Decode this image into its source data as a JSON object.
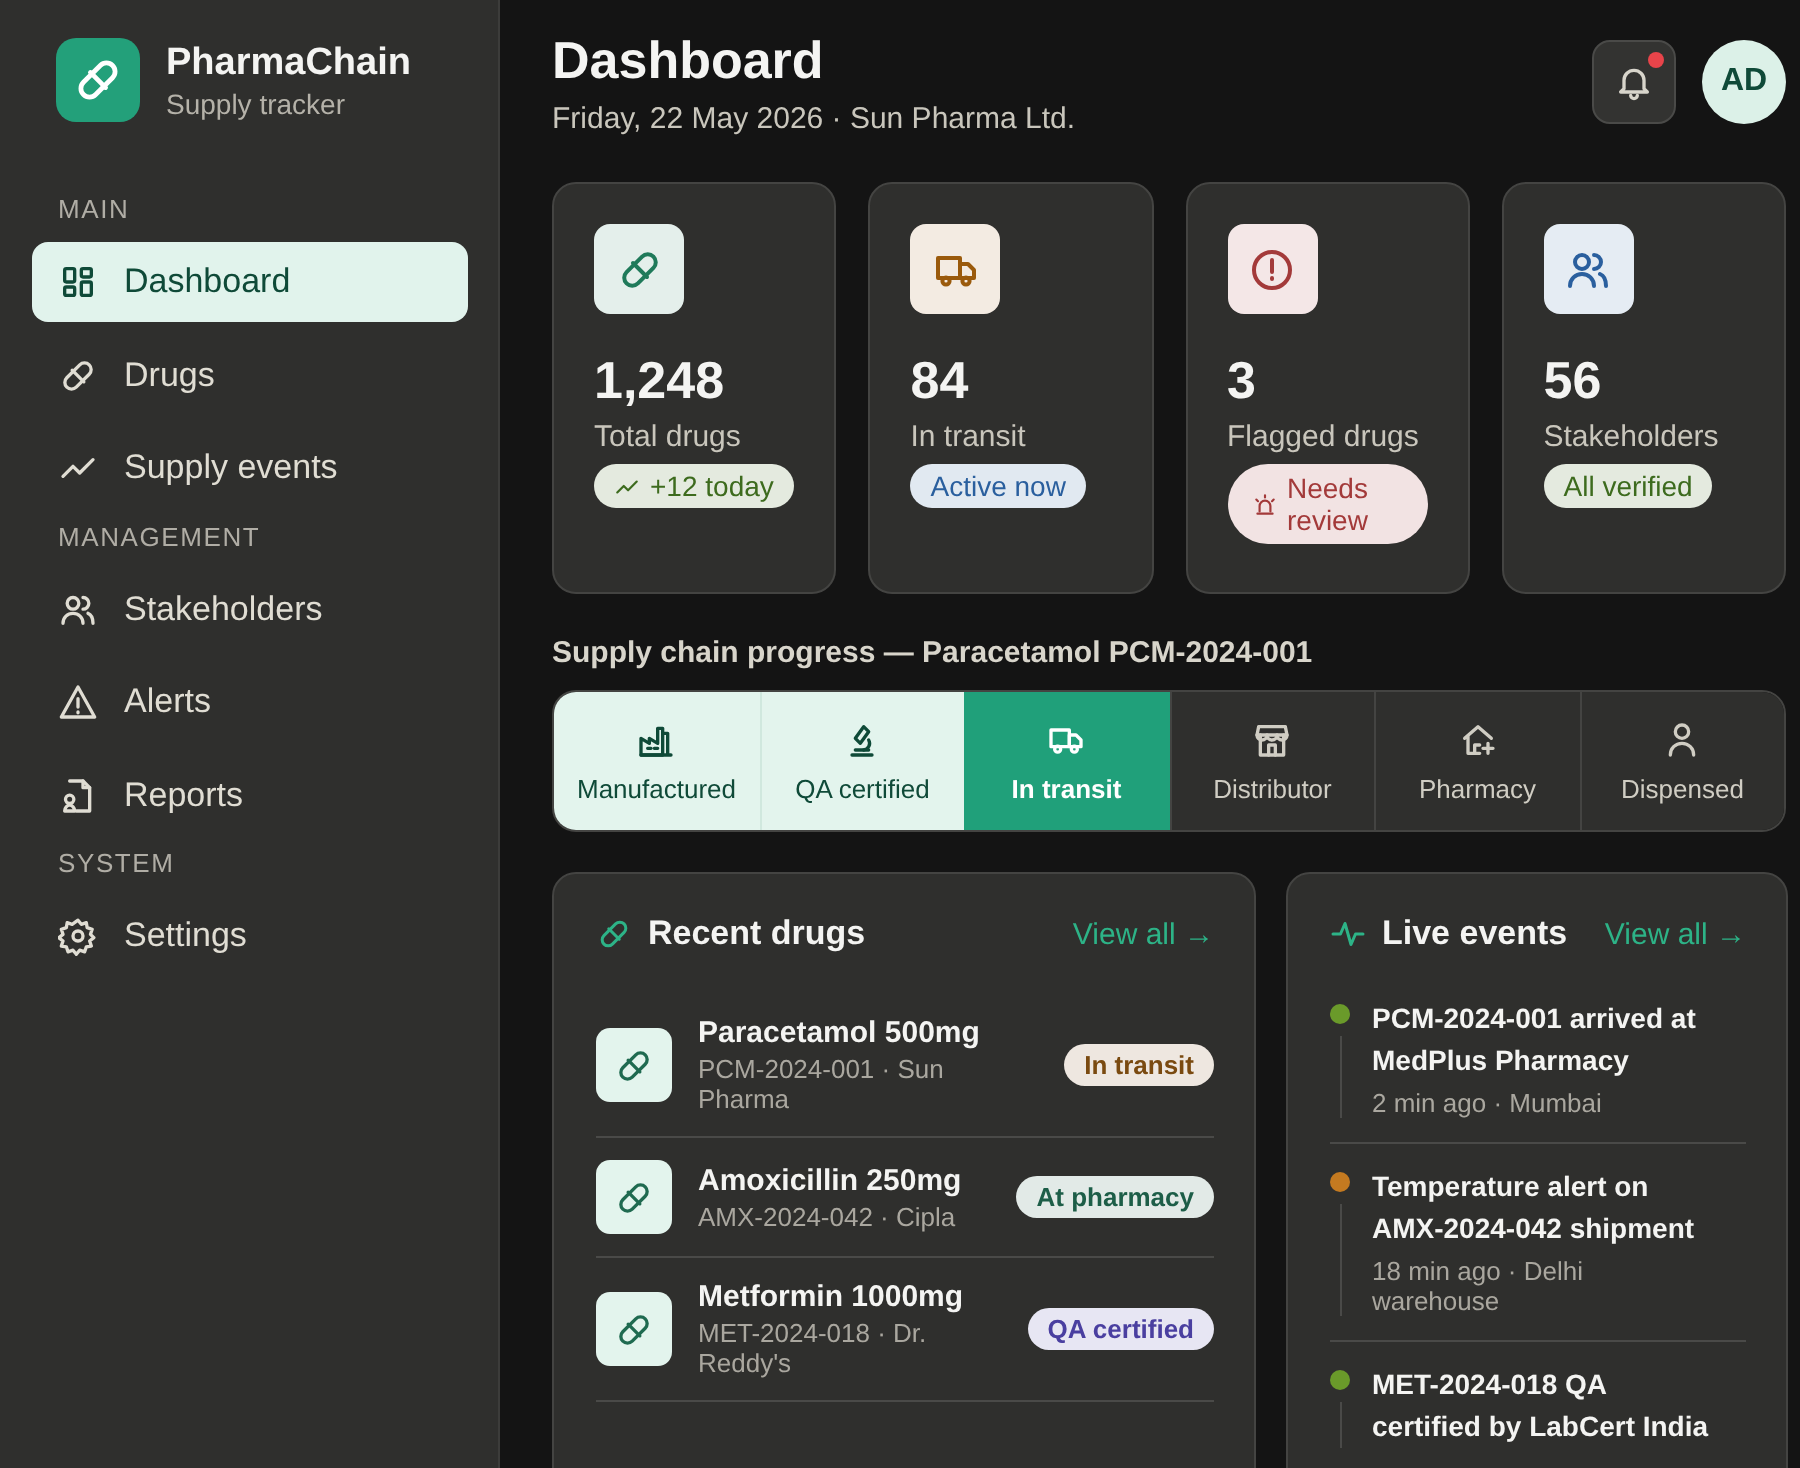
{
  "sidebar": {
    "brand": {
      "name": "PharmaChain",
      "tagline": "Supply tracker"
    },
    "sections": [
      {
        "heading": "MAIN",
        "items": [
          {
            "label": "Dashboard",
            "selected": true
          },
          {
            "label": "Drugs",
            "selected": false
          },
          {
            "label": "Supply events",
            "selected": false
          }
        ]
      },
      {
        "heading": "MANAGEMENT",
        "items": [
          {
            "label": "Stakeholders",
            "selected": false
          },
          {
            "label": "Alerts",
            "selected": false
          },
          {
            "label": "Reports",
            "selected": false
          }
        ]
      },
      {
        "heading": "SYSTEM",
        "items": [
          {
            "label": "Settings",
            "selected": false
          }
        ]
      }
    ]
  },
  "header": {
    "title": "Dashboard",
    "subtitle": "Friday, 22 May 2026 · Sun Pharma Ltd.",
    "notifications": {
      "unread": true
    },
    "avatar": "AD"
  },
  "stats": [
    {
      "value": "1,248",
      "label": "Total drugs",
      "badge": "+12 today"
    },
    {
      "value": "84",
      "label": "In transit",
      "badge": "Active now"
    },
    {
      "value": "3",
      "label": "Flagged drugs",
      "badge": "Needs review"
    },
    {
      "value": "56",
      "label": "Stakeholders",
      "badge": "All verified"
    }
  ],
  "progress": {
    "title": "Supply chain progress — Paracetamol PCM-2024-001",
    "steps": [
      {
        "label": "Manufactured",
        "completed": true,
        "selected": false
      },
      {
        "label": "QA certified",
        "completed": true,
        "selected": false
      },
      {
        "label": "In transit",
        "completed": false,
        "selected": true
      },
      {
        "label": "Distributor",
        "completed": false,
        "selected": false
      },
      {
        "label": "Pharmacy",
        "completed": false,
        "selected": false
      },
      {
        "label": "Dispensed",
        "completed": false,
        "selected": false
      }
    ]
  },
  "recent_drugs": {
    "title": "Recent drugs",
    "link": "View all →",
    "rows": [
      {
        "name": "Paracetamol 500mg",
        "meta": "PCM-2024-001 · Sun Pharma",
        "status": "In transit",
        "kind": "transit"
      },
      {
        "name": "Amoxicillin 250mg",
        "meta": "AMX-2024-042 · Cipla",
        "status": "At pharmacy",
        "kind": "pharmacy"
      },
      {
        "name": "Metformin 1000mg",
        "meta": "MET-2024-018 · Dr. Reddy's",
        "status": "QA certified",
        "kind": "certified"
      }
    ]
  },
  "live_events": {
    "title": "Live events",
    "link": "View all →",
    "events": [
      {
        "text": "PCM-2024-001 arrived at MedPlus Pharmacy",
        "meta": "2 min ago · Mumbai",
        "color": "#6a9a2a"
      },
      {
        "text": "Temperature alert on AMX-2024-042 shipment",
        "meta": "18 min ago · Delhi warehouse",
        "color": "#c47a20"
      },
      {
        "text": "MET-2024-018 QA certified by LabCert India",
        "color": "#6a9a2a"
      }
    ]
  }
}
